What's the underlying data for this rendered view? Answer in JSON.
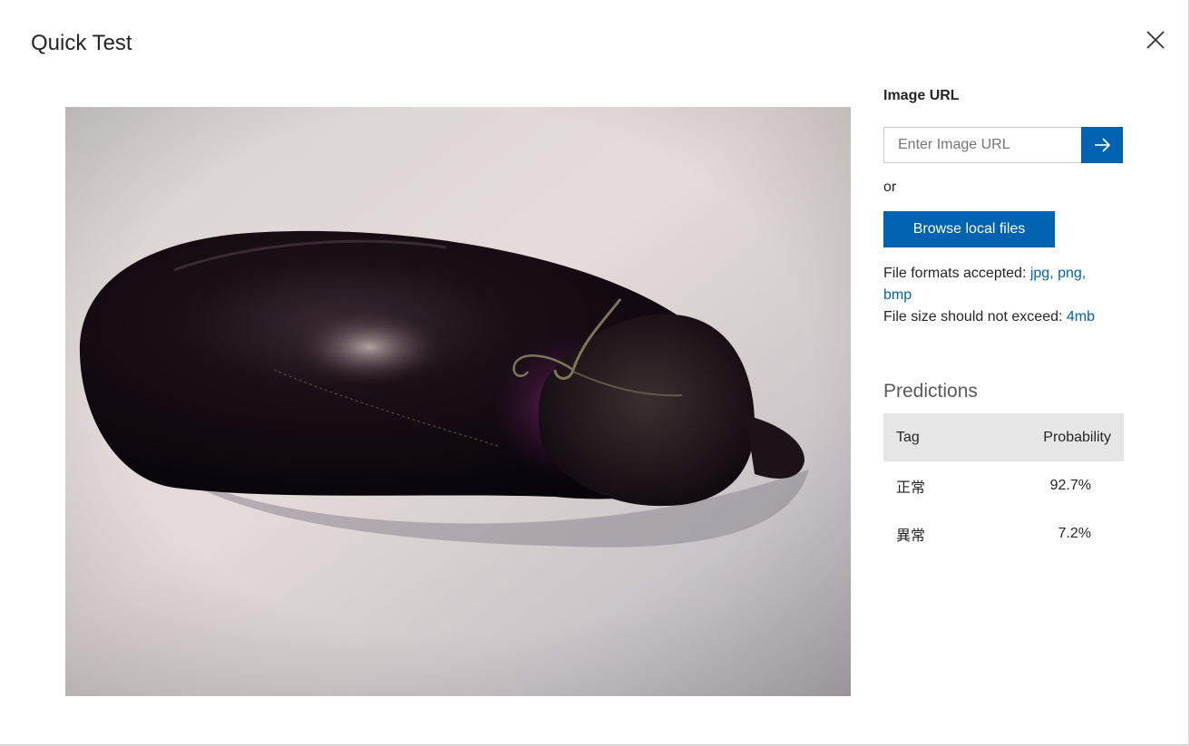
{
  "dialog": {
    "title": "Quick Test"
  },
  "preview": {
    "subject": "eggplant photo"
  },
  "url_section": {
    "label": "Image URL",
    "placeholder": "Enter Image URL",
    "or_text": "or",
    "browse_label": "Browse local files"
  },
  "file_info": {
    "formats_label": "File formats accepted: ",
    "formats_value": "jpg, png, bmp",
    "size_label": "File size should not exceed: ",
    "size_value": "4mb"
  },
  "predictions": {
    "title": "Predictions",
    "headers": {
      "tag": "Tag",
      "probability": "Probability"
    },
    "rows": [
      {
        "tag": "正常",
        "probability": "92.7%"
      },
      {
        "tag": "異常",
        "probability": "7.2%"
      }
    ]
  },
  "colors": {
    "accent": "#0063b1",
    "header_bg": "#e6e6e6"
  },
  "icons": {
    "close": "close-icon",
    "submit": "arrow-right-icon"
  }
}
